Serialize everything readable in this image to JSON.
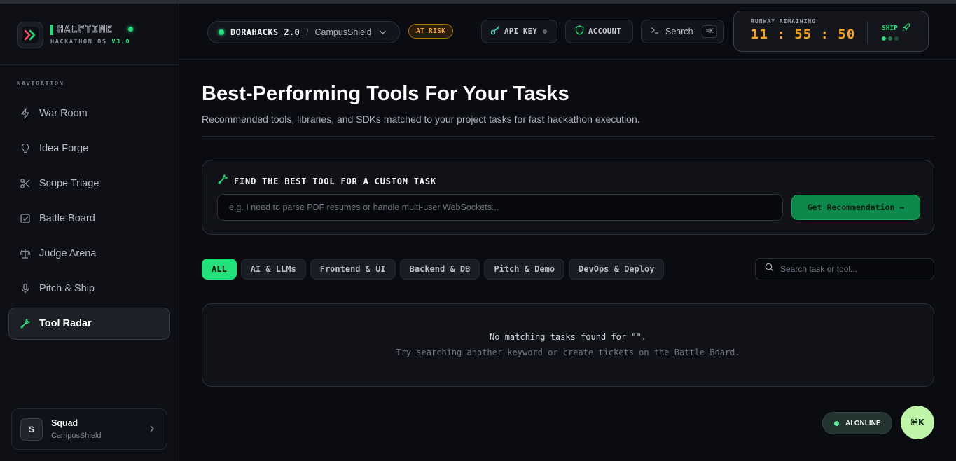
{
  "brand": {
    "name": "HALFTIME",
    "subtitle": "HACKATHON OS",
    "version": "V3.0",
    "accent": "#22e07a"
  },
  "sidebar": {
    "section_label": "NAVIGATION",
    "items": [
      {
        "label": "War Room",
        "icon": "bolt-icon",
        "active": false
      },
      {
        "label": "Idea Forge",
        "icon": "lightbulb-icon",
        "active": false
      },
      {
        "label": "Scope Triage",
        "icon": "scissors-icon",
        "active": false
      },
      {
        "label": "Battle Board",
        "icon": "checkbox-icon",
        "active": false
      },
      {
        "label": "Judge Arena",
        "icon": "scale-icon",
        "active": false
      },
      {
        "label": "Pitch & Ship",
        "icon": "microphone-icon",
        "active": false
      },
      {
        "label": "Tool Radar",
        "icon": "wrench-icon",
        "active": true
      }
    ],
    "squad": {
      "avatar_letter": "S",
      "name": "Squad",
      "project": "CampusShield"
    }
  },
  "topbar": {
    "hackathon": "DORAHACKS 2.0",
    "separator": "/",
    "project": "CampusShield",
    "risk_badge": "AT RISK",
    "api_key_label": "API KEY",
    "account_label": "ACCOUNT",
    "search_label": "Search",
    "search_shortcut": "⌘K",
    "runway": {
      "label": "RUNWAY REMAINING",
      "time": "11 : 55 : 50",
      "ship_label": "SHIP"
    }
  },
  "main": {
    "title": "Best-Performing Tools For Your Tasks",
    "subtitle": "Recommended tools, libraries, and SDKs matched to your project tasks for fast hackathon execution.",
    "finder": {
      "title": "FIND THE BEST TOOL FOR A CUSTOM TASK",
      "input_value": "",
      "placeholder": "e.g. I need to parse PDF resumes or handle multi-user WebSockets...",
      "button_label": "Get Recommendation →"
    },
    "filters": [
      {
        "label": "ALL",
        "active": true
      },
      {
        "label": "AI & LLMs",
        "active": false
      },
      {
        "label": "Frontend & UI",
        "active": false
      },
      {
        "label": "Backend & DB",
        "active": false
      },
      {
        "label": "Pitch & Demo",
        "active": false
      },
      {
        "label": "DevOps & Deploy",
        "active": false
      }
    ],
    "tool_search": {
      "placeholder": "Search task or tool...",
      "value": ""
    },
    "empty_state": {
      "line1": "No matching tasks found for \"\".",
      "line2": "Try searching another keyword or create tickets on the Battle Board."
    }
  },
  "floating": {
    "ai_status": "AI ONLINE",
    "command_button": "⌘K"
  }
}
